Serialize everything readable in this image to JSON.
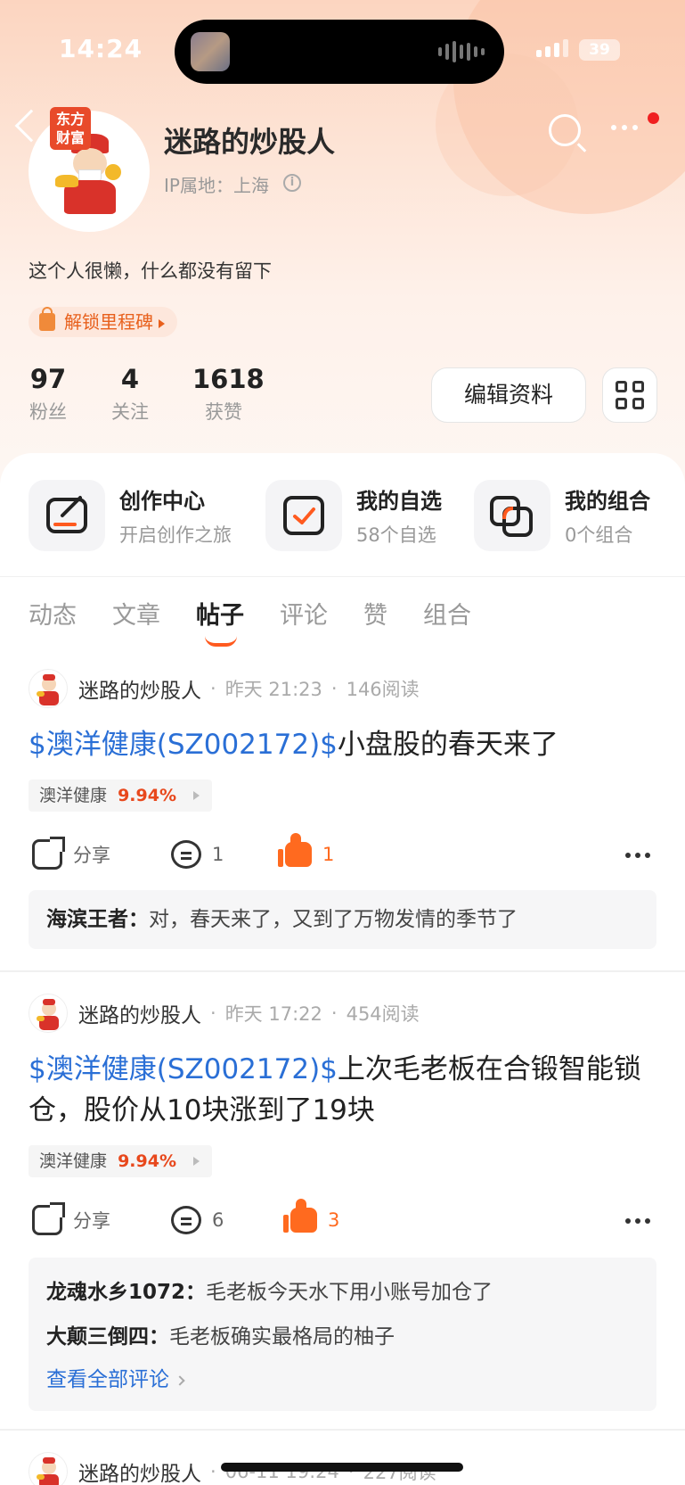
{
  "status_bar": {
    "time": "14:24",
    "battery": "39"
  },
  "profile": {
    "brand_badge": "东方财富",
    "username": "迷路的炒股人",
    "ip_location": "IP属地：上海",
    "bio": "这个人很懒，什么都没有留下",
    "milestone_label": "解锁里程碑",
    "stats": [
      {
        "value": "97",
        "label": "粉丝"
      },
      {
        "value": "4",
        "label": "关注"
      },
      {
        "value": "1618",
        "label": "获赞"
      }
    ],
    "edit_button": "编辑资料"
  },
  "quick_links": [
    {
      "title": "创作中心",
      "subtitle": "开启创作之旅",
      "icon": "creation-icon"
    },
    {
      "title": "我的自选",
      "subtitle": "58个自选",
      "icon": "watchlist-icon"
    },
    {
      "title": "我的组合",
      "subtitle": "0个组合",
      "icon": "portfolio-icon"
    }
  ],
  "tabs": [
    "动态",
    "文章",
    "帖子",
    "评论",
    "赞",
    "组合"
  ],
  "active_tab": "帖子",
  "actions": {
    "share": "分享"
  },
  "posts": [
    {
      "author": "迷路的炒股人",
      "time": "昨天 21:23",
      "reads": "146阅读",
      "ticker": "$澳洋健康(SZ002172)$",
      "text": "小盘股的春天来了",
      "stock_name": "澳洋健康",
      "stock_change": "9.94%",
      "comment_count": "1",
      "like_count": "1",
      "comments": [
        {
          "user": "海滨王者",
          "text": "对，春天来了，又到了万物发情的季节了"
        }
      ]
    },
    {
      "author": "迷路的炒股人",
      "time": "昨天 17:22",
      "reads": "454阅读",
      "ticker": "$澳洋健康(SZ002172)$",
      "text": "上次毛老板在合锻智能锁仓，股价从10块涨到了19块",
      "stock_name": "澳洋健康",
      "stock_change": "9.94%",
      "comment_count": "6",
      "like_count": "3",
      "comments": [
        {
          "user": "龙魂水乡1072",
          "text": "毛老板今天水下用小账号加仓了"
        },
        {
          "user": "大颠三倒四",
          "text": "毛老板确实最格局的柚子"
        }
      ],
      "view_all": "查看全部评论"
    },
    {
      "author": "迷路的炒股人",
      "time": "06-11 19:24",
      "reads": "227阅读"
    }
  ],
  "colors": {
    "accent": "#ff5a1f",
    "link_blue": "#2a6fd6",
    "rise_red": "#e8481c"
  }
}
